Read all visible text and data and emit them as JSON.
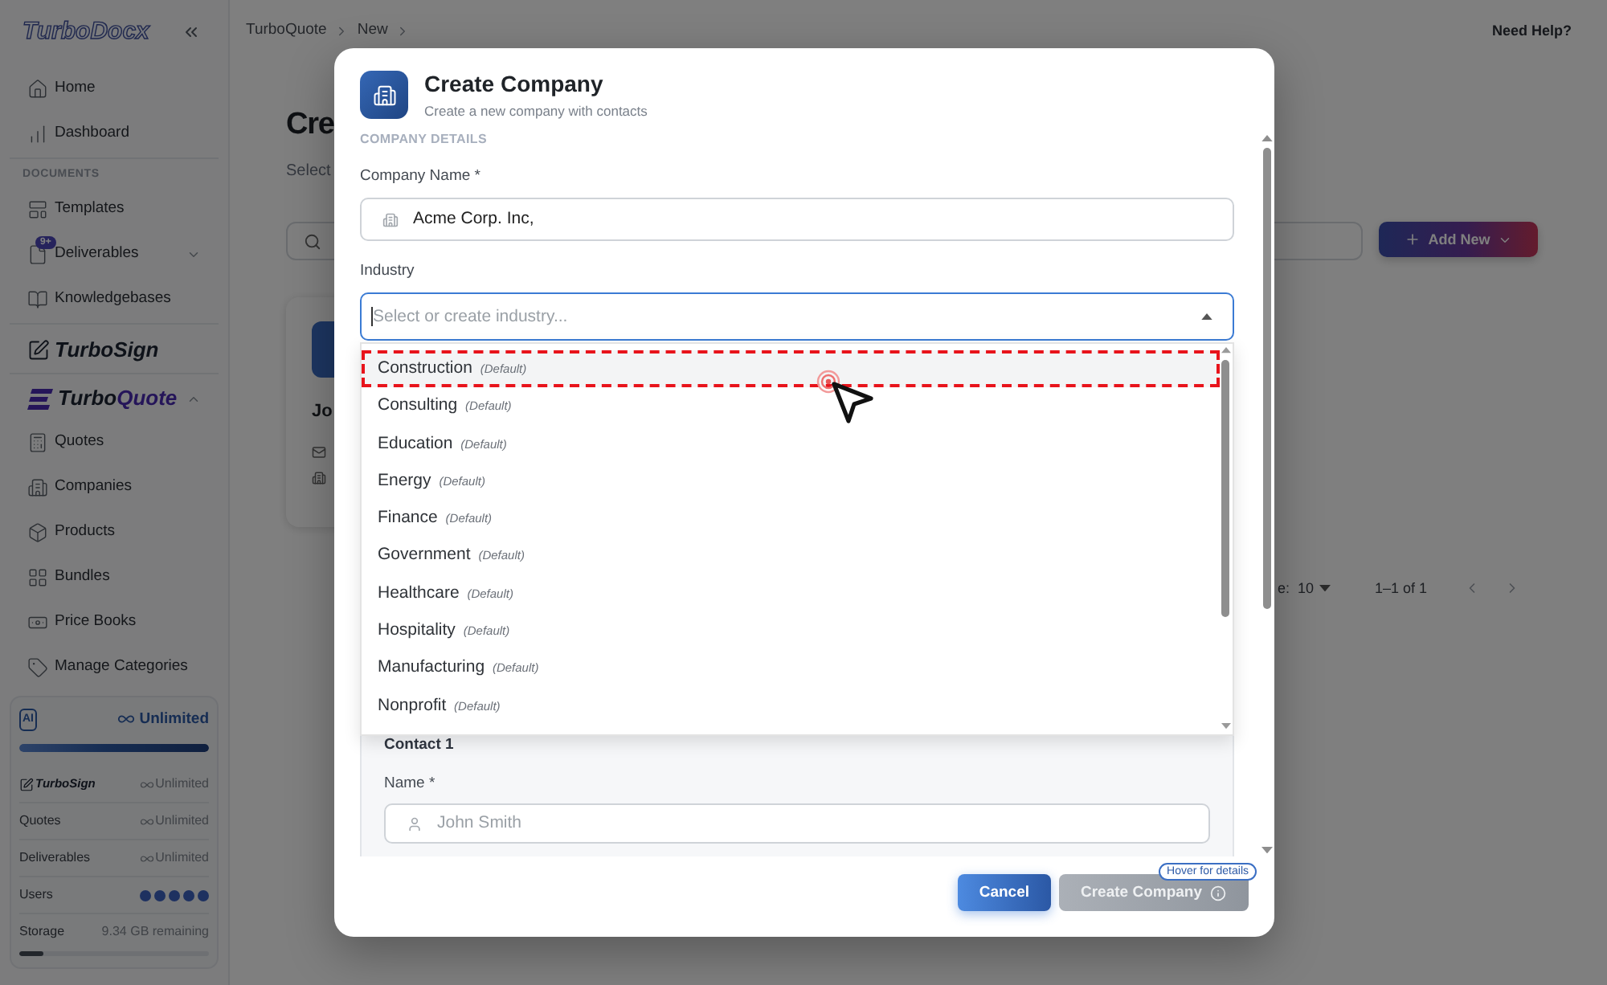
{
  "sidebar": {
    "logo": "TurboDocx",
    "main_items": [
      {
        "label": "Home"
      },
      {
        "label": "Dashboard"
      }
    ],
    "documents_title": "DOCUMENTS",
    "document_items": [
      {
        "label": "Templates"
      },
      {
        "label": "Deliverables",
        "badge": "9+",
        "expanded": false
      },
      {
        "label": "Knowledgebases"
      }
    ],
    "turbosign": {
      "label": "TurboSign"
    },
    "turboquote": {
      "label_start": "Turbo",
      "label_end": "Quote",
      "expanded": true
    },
    "quote_items": [
      {
        "label": "Quotes"
      },
      {
        "label": "Companies"
      },
      {
        "label": "Products"
      },
      {
        "label": "Bundles"
      },
      {
        "label": "Price Books"
      },
      {
        "label": "Manage Categories"
      }
    ],
    "usage": {
      "badge": "AI",
      "plan": "Unlimited",
      "level": 1,
      "rows": [
        {
          "kind": "logo",
          "label": "TurboSign",
          "value": "Unlimited"
        },
        {
          "kind": "text",
          "label": "Quotes",
          "value": "Unlimited"
        },
        {
          "kind": "text",
          "label": "Deliverables",
          "value": "Unlimited"
        },
        {
          "kind": "dots",
          "label": "Users"
        },
        {
          "kind": "meter",
          "label": "Storage",
          "value": "9.34 GB remaining",
          "level": 0.13
        }
      ]
    }
  },
  "topbar": {
    "breadcrumb": [
      {
        "label": "TurboQuote"
      },
      {
        "label": "New"
      }
    ],
    "help": "Need Help?"
  },
  "page": {
    "title": "Cre",
    "subtitle": "Select",
    "add_button": "Add New",
    "card": {
      "title": "Jo"
    },
    "pagination": {
      "rows_label": "e:",
      "rows_value": "10",
      "range": "1–1 of 1"
    }
  },
  "dialog": {
    "title": "Create Company",
    "subtitle": "Create a new company with contacts",
    "section_title": "COMPANY DETAILS",
    "company_name": {
      "label": "Company Name *",
      "value": "Acme Corp. Inc,"
    },
    "industry": {
      "label": "Industry",
      "placeholder": "Select or create industry...",
      "focused": true,
      "expanded": true,
      "options": [
        {
          "name": "Construction",
          "tag": "(Default)",
          "highlighted": true
        },
        {
          "name": "Consulting",
          "tag": "(Default)",
          "highlighted": false
        },
        {
          "name": "Education",
          "tag": "(Default)",
          "highlighted": false
        },
        {
          "name": "Energy",
          "tag": "(Default)",
          "highlighted": false
        },
        {
          "name": "Finance",
          "tag": "(Default)",
          "highlighted": false
        },
        {
          "name": "Government",
          "tag": "(Default)",
          "highlighted": false
        },
        {
          "name": "Healthcare",
          "tag": "(Default)",
          "highlighted": false
        },
        {
          "name": "Hospitality",
          "tag": "(Default)",
          "highlighted": false
        },
        {
          "name": "Manufacturing",
          "tag": "(Default)",
          "highlighted": false
        },
        {
          "name": "Nonprofit",
          "tag": "(Default)",
          "highlighted": false
        }
      ]
    },
    "contact": {
      "title": "Contact 1",
      "name": {
        "label": "Name *",
        "placeholder": "John Smith"
      }
    },
    "buttons": [
      {
        "kind": "cancel",
        "label": "Cancel",
        "disabled": false
      },
      {
        "kind": "submit",
        "label": "Create Company",
        "disabled": true,
        "hint": "Hover for details"
      }
    ]
  }
}
